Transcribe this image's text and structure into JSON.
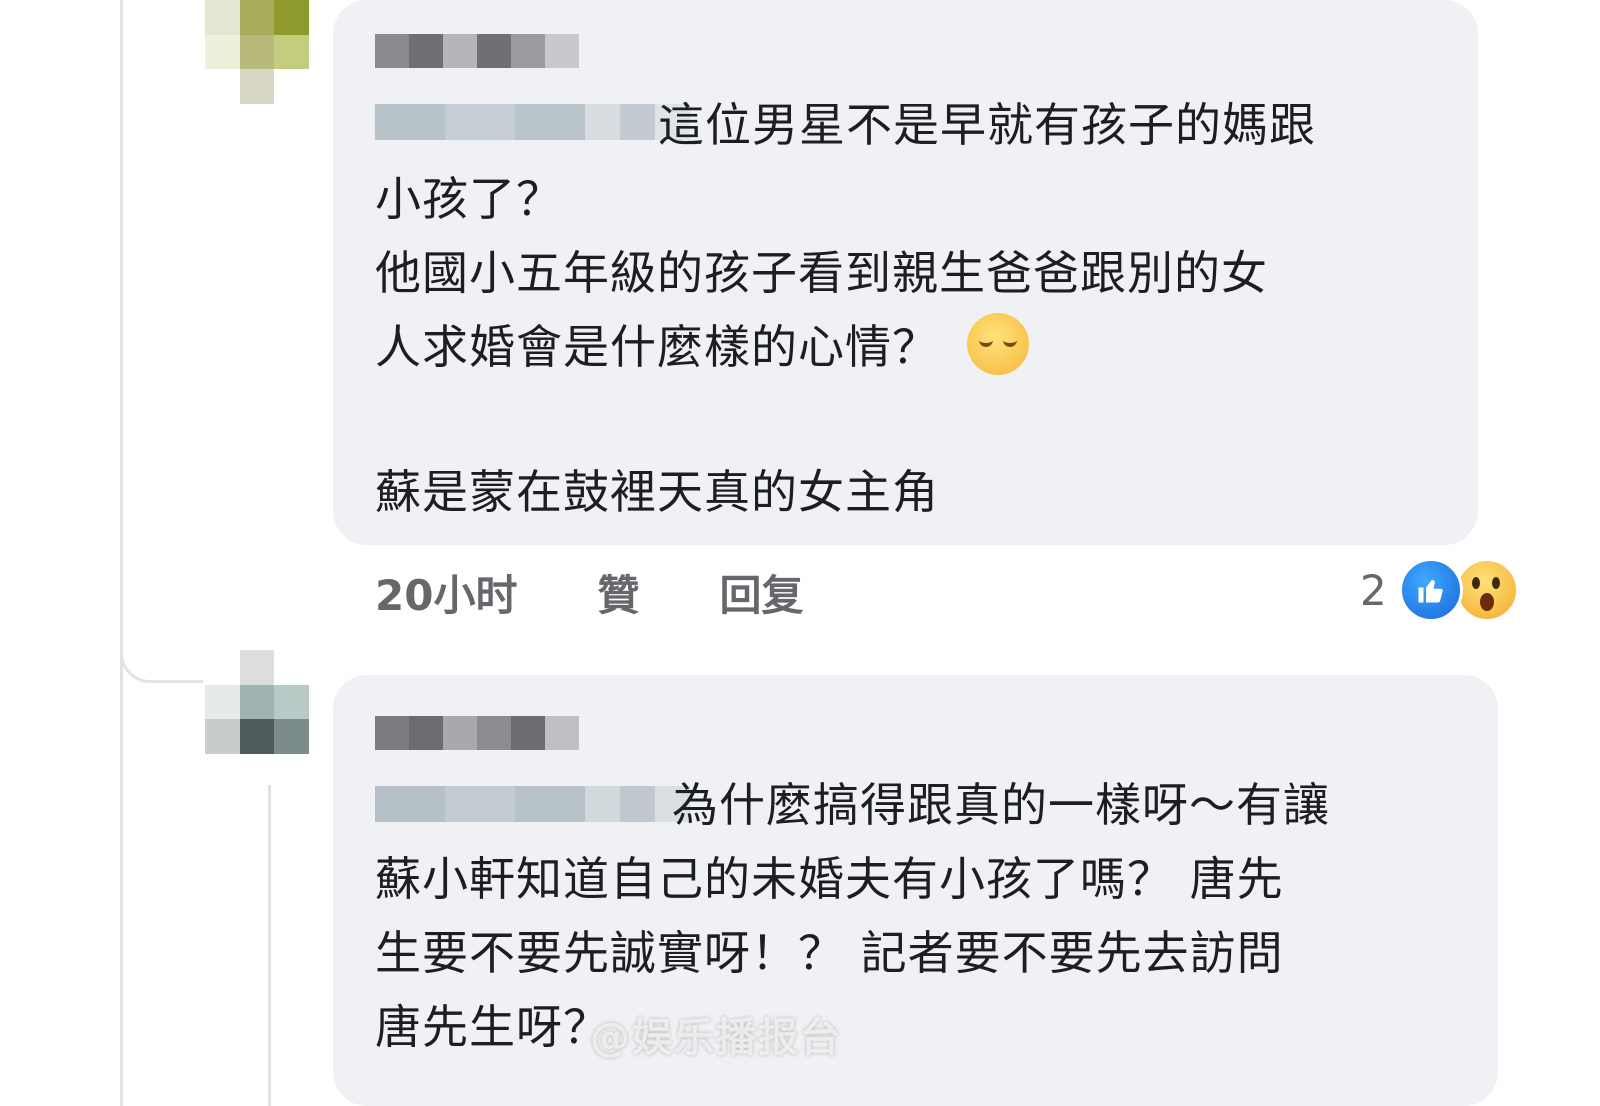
{
  "comments": [
    {
      "text_first": "這位男星不是早就有孩子的媽跟",
      "text_body": "小孩了？\n他國小五年級的孩子看到親生爸爸跟別的女\n人求婚會是什麼樣的心情？",
      "text_tail": "蘇是蒙在鼓裡天真的女主角",
      "emoji": "pensive-face",
      "meta": {
        "time": "20小时",
        "like": "贊",
        "reply": "回复"
      },
      "reactions": {
        "count": "2",
        "icons": [
          "like-icon",
          "wow-icon"
        ]
      }
    },
    {
      "text_first": "為什麼搞得跟真的一樣呀～有讓",
      "text_body": "蘇小軒知道自己的未婚夫有小孩了嗎？ 唐先\n生要不要先誠實呀！？ 記者要不要先去訪問\n唐先生呀？"
    }
  ],
  "watermark": "@娱乐播报台"
}
